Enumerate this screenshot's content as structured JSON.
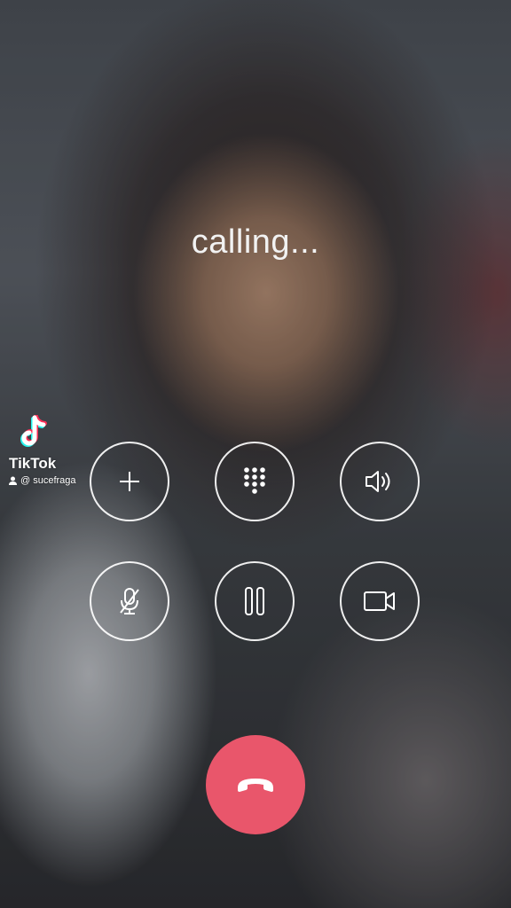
{
  "call": {
    "status_text": "calling..."
  },
  "controls": [
    {
      "id": "add-call",
      "icon": "plus-icon"
    },
    {
      "id": "keypad",
      "icon": "keypad-icon"
    },
    {
      "id": "speaker",
      "icon": "speaker-icon"
    },
    {
      "id": "mute",
      "icon": "mic-off-icon"
    },
    {
      "id": "hold",
      "icon": "pause-icon"
    },
    {
      "id": "video",
      "icon": "video-camera-icon"
    }
  ],
  "end_call": {
    "icon": "phone-hangup-icon",
    "color": "#e9566b"
  },
  "watermark": {
    "brand": "TikTok",
    "username": "@ sucefraga",
    "icon": "tiktok-logo-icon"
  }
}
